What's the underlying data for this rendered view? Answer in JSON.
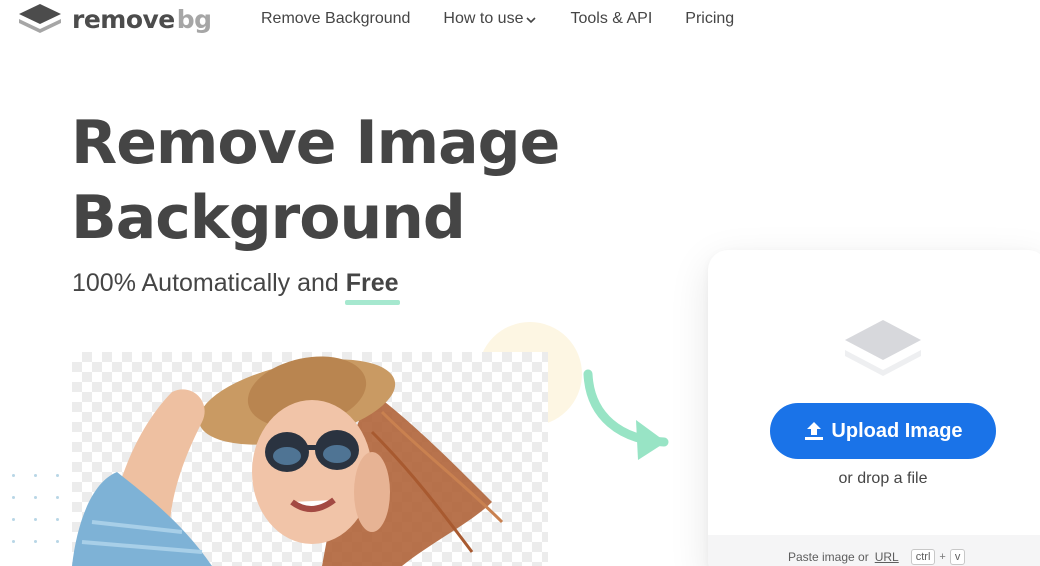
{
  "header": {
    "logo_main": "remove",
    "logo_suffix": "bg",
    "nav": [
      {
        "label": "Remove Background"
      },
      {
        "label": "How to use",
        "has_dropdown": true
      },
      {
        "label": "Tools & API"
      },
      {
        "label": "Pricing"
      }
    ]
  },
  "hero": {
    "title_line1": "Remove Image",
    "title_line2": "Background",
    "subtitle_prefix": "100% Automatically and ",
    "subtitle_highlight": "Free"
  },
  "upload": {
    "button_label": "Upload Image",
    "drop_text": "or drop a file",
    "paste_prefix": "Paste image or",
    "paste_url": "URL",
    "kbd_ctrl": "ctrl",
    "kbd_plus": "+",
    "kbd_v": "v"
  },
  "colors": {
    "primary": "#1a73e8",
    "text": "#454545",
    "accent_green": "#a6e8cf",
    "arrow_green": "#98e4c5",
    "logo_gray": "#a6a6a6"
  },
  "icons": {
    "logo": "layers-icon",
    "upload": "upload-icon",
    "card": "layers-stack-icon",
    "nav_dropdown": "chevron-down-icon"
  }
}
